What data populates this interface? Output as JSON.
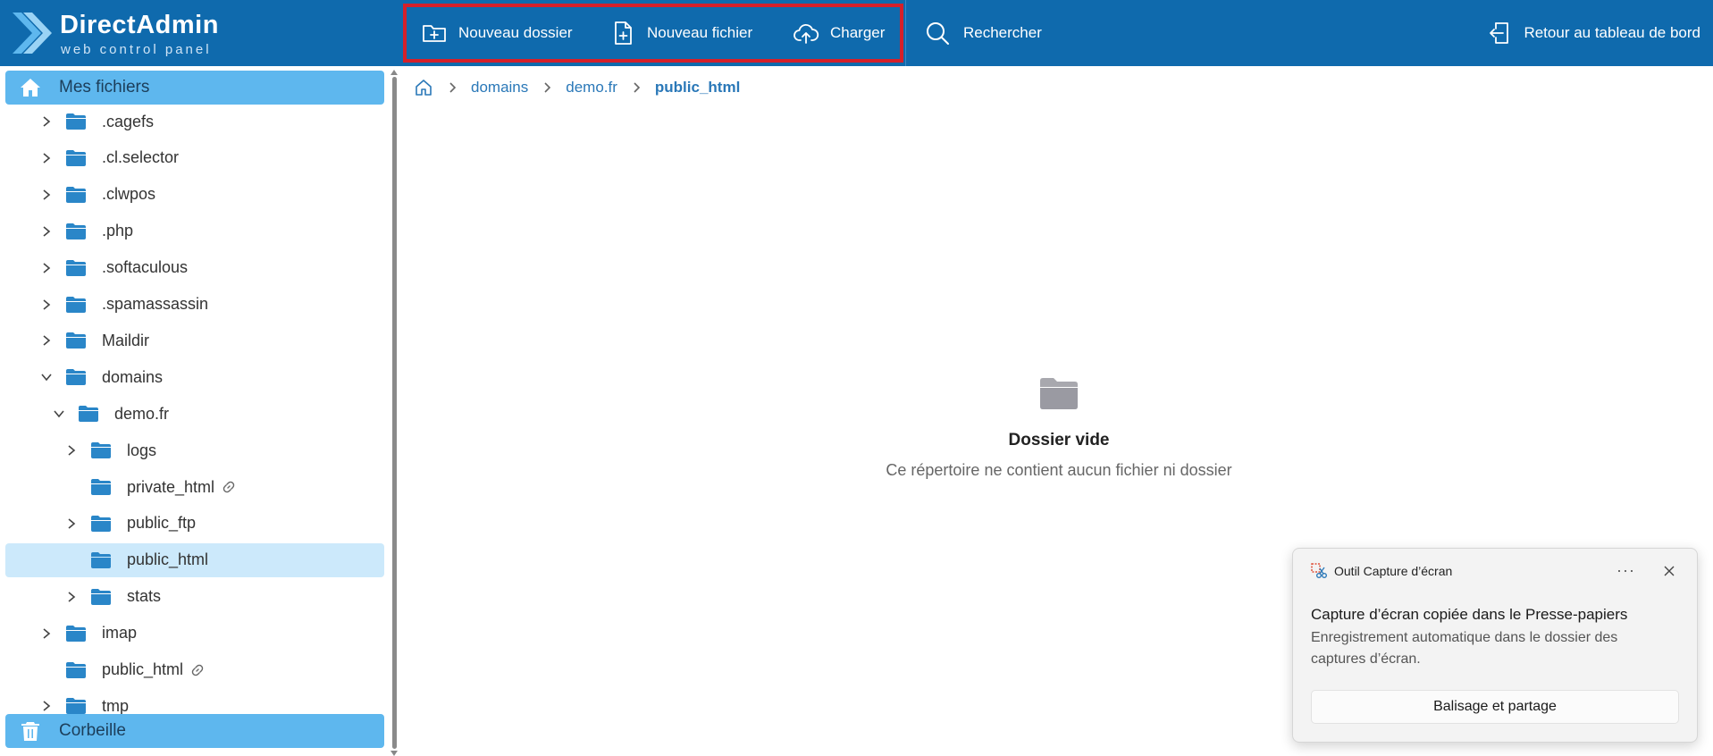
{
  "app": {
    "brand_title": "DirectAdmin",
    "brand_subtitle": "web control panel"
  },
  "toolbar": {
    "new_folder": "Nouveau dossier",
    "new_file": "Nouveau fichier",
    "upload": "Charger",
    "search": "Rechercher",
    "back": "Retour au tableau de bord"
  },
  "sidebar": {
    "home_label": "Mes fichiers",
    "trash_label": "Corbeille",
    "tree": [
      {
        "label": ".cagefs",
        "expandable": true,
        "expanded": false,
        "level": 0
      },
      {
        "label": ".cl.selector",
        "expandable": true,
        "expanded": false,
        "level": 0
      },
      {
        "label": ".clwpos",
        "expandable": true,
        "expanded": false,
        "level": 0
      },
      {
        "label": ".php",
        "expandable": true,
        "expanded": false,
        "level": 0
      },
      {
        "label": ".softaculous",
        "expandable": true,
        "expanded": false,
        "level": 0
      },
      {
        "label": ".spamassassin",
        "expandable": true,
        "expanded": false,
        "level": 0
      },
      {
        "label": "Maildir",
        "expandable": true,
        "expanded": false,
        "level": 0
      },
      {
        "label": "domains",
        "expandable": true,
        "expanded": true,
        "level": 0
      },
      {
        "label": "demo.fr",
        "expandable": true,
        "expanded": true,
        "level": 1
      },
      {
        "label": "logs",
        "expandable": true,
        "expanded": false,
        "level": 2
      },
      {
        "label": "private_html",
        "expandable": false,
        "expanded": false,
        "level": 2,
        "link": true
      },
      {
        "label": "public_ftp",
        "expandable": true,
        "expanded": false,
        "level": 2
      },
      {
        "label": "public_html",
        "expandable": false,
        "expanded": false,
        "level": 2,
        "selected": true
      },
      {
        "label": "stats",
        "expandable": true,
        "expanded": false,
        "level": 2
      },
      {
        "label": "imap",
        "expandable": true,
        "expanded": false,
        "level": 0
      },
      {
        "label": "public_html",
        "expandable": false,
        "expanded": false,
        "level": 0,
        "link": true
      },
      {
        "label": "tmp",
        "expandable": true,
        "expanded": false,
        "level": 0
      }
    ]
  },
  "breadcrumb": {
    "items": [
      "domains",
      "demo.fr"
    ],
    "current": "public_html"
  },
  "empty_state": {
    "title": "Dossier vide",
    "subtitle": "Ce répertoire ne contient aucun fichier ni dossier"
  },
  "toast": {
    "app_name": "Outil Capture d’écran",
    "more": "···",
    "title": "Capture d’écran copiée dans le Presse-papiers",
    "body": "Enregistrement automatique dans le dossier des captures d’écran.",
    "action": "Balisage et partage"
  },
  "colors": {
    "topbar": "#0f6aad",
    "highlight_border": "#d5202a",
    "sidebar_header": "#5eb7ee",
    "selected_row": "#cce9fb",
    "folder": "#2a86c8",
    "link": "#2a78b8"
  }
}
